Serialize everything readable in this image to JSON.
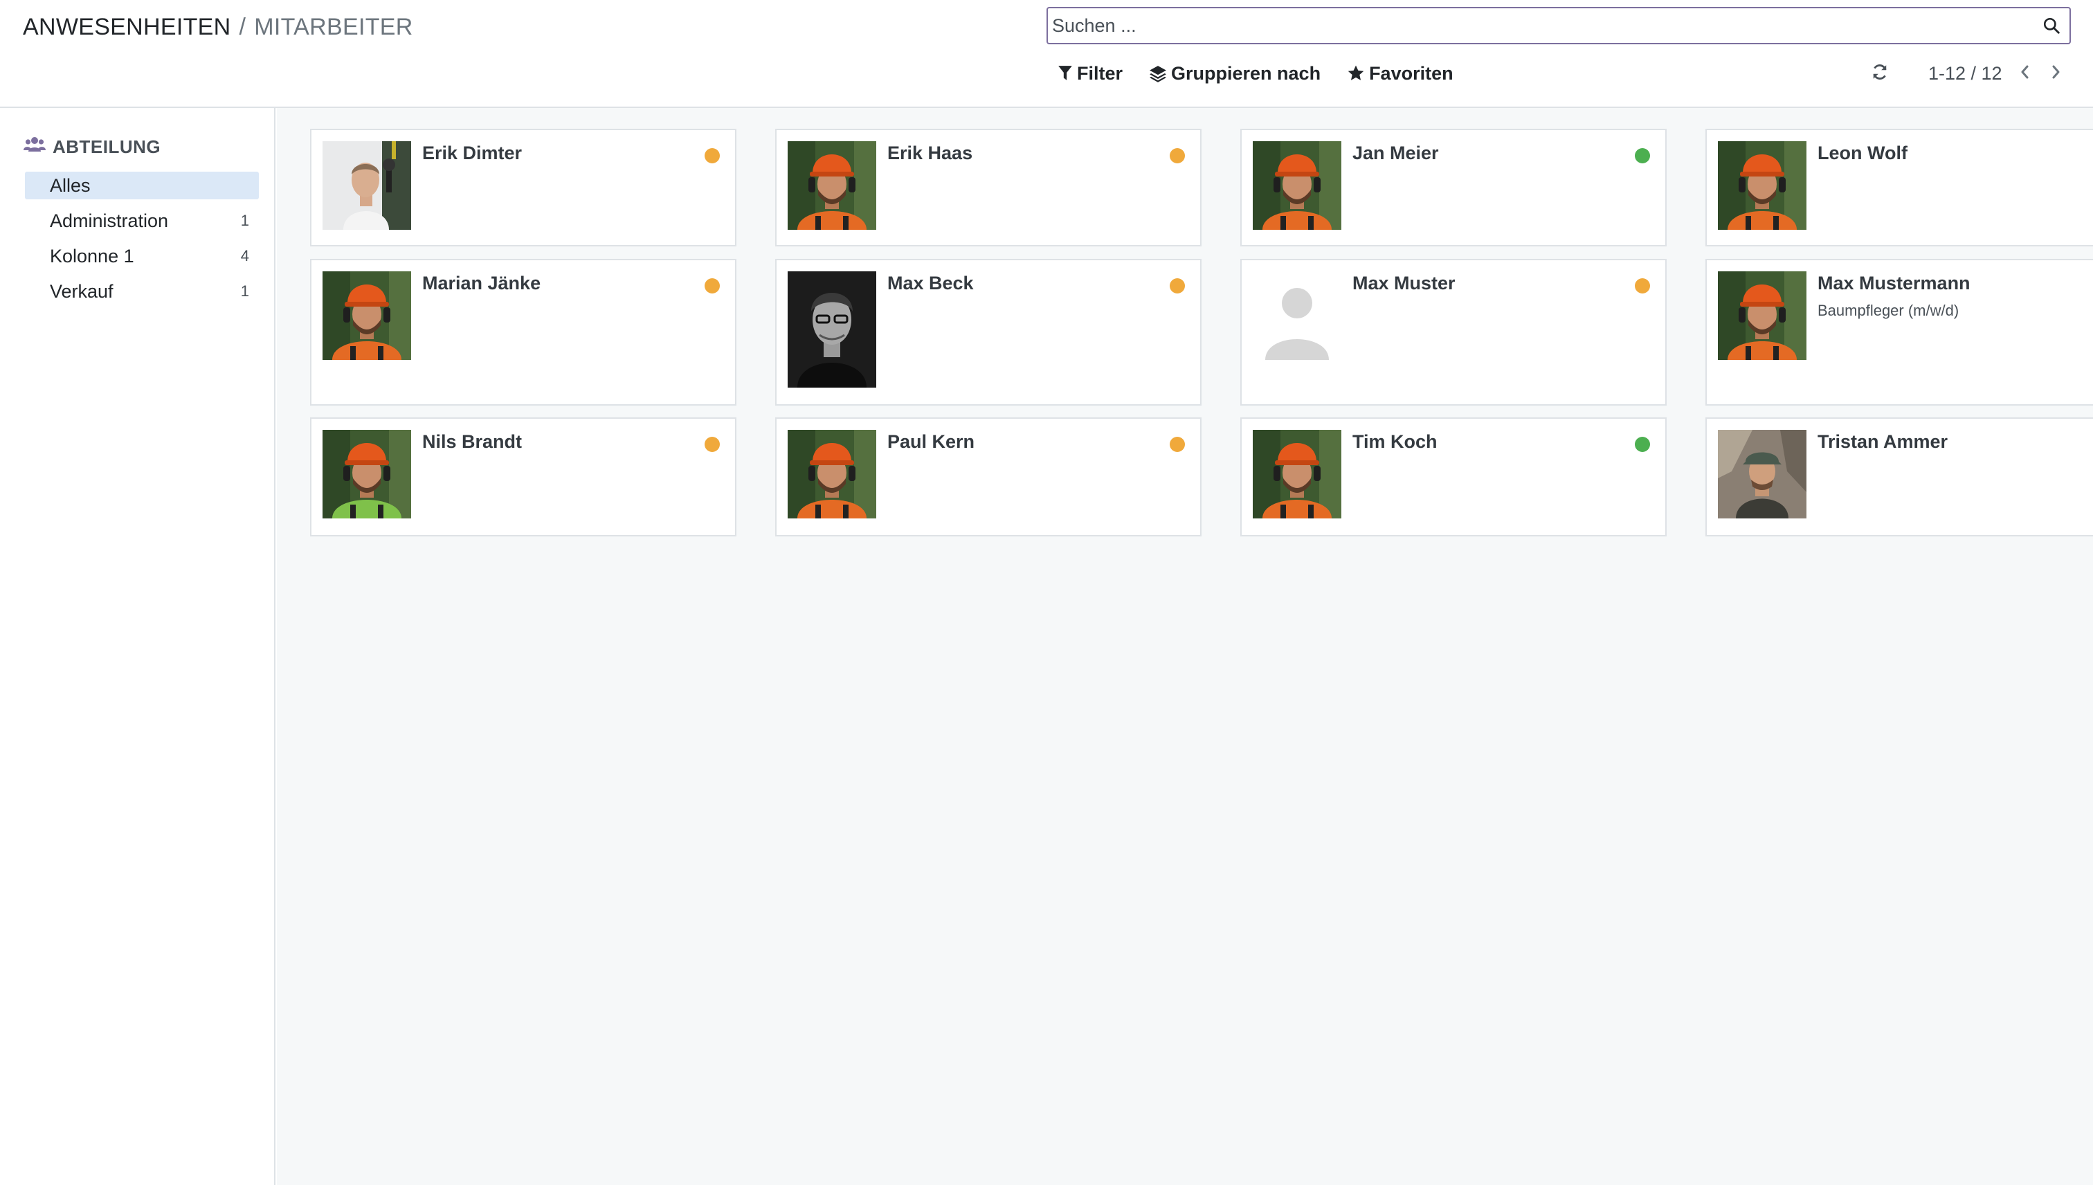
{
  "breadcrumb": {
    "parent": "ANWESENHEITEN",
    "separator": "/",
    "current": "MITARBEITER"
  },
  "search": {
    "placeholder": "Suchen ...",
    "value": ""
  },
  "toolbar": {
    "filter_label": "Filter",
    "group_by_label": "Gruppieren nach",
    "favorites_label": "Favoriten"
  },
  "pager": {
    "value": "1-12 / 12"
  },
  "sidebar": {
    "title": "ABTEILUNG",
    "items": [
      {
        "label": "Alles",
        "count": ""
      },
      {
        "label": "Administration",
        "count": "1"
      },
      {
        "label": "Kolonne 1",
        "count": "4"
      },
      {
        "label": "Verkauf",
        "count": "1"
      }
    ]
  },
  "colors": {
    "present": "#4caf50",
    "absent": "#f0a93b",
    "accent": "#7c6f9e",
    "active_filter": "#dbe8f7"
  },
  "employees": [
    {
      "name": "Erik Dimter",
      "job": "",
      "status": "absent",
      "avatar": "photo-office"
    },
    {
      "name": "Erik Haas",
      "job": "",
      "status": "absent",
      "avatar": "photo-arborist"
    },
    {
      "name": "Jan Meier",
      "job": "",
      "status": "present",
      "avatar": "photo-arborist"
    },
    {
      "name": "Leon Wolf",
      "job": "",
      "status": "present",
      "avatar": "photo-arborist"
    },
    {
      "name": "Marian Jänke",
      "job": "",
      "status": "absent",
      "avatar": "photo-arborist"
    },
    {
      "name": "Max Beck",
      "job": "",
      "status": "absent",
      "avatar": "photo-bw-portrait"
    },
    {
      "name": "Max Muster",
      "job": "",
      "status": "absent",
      "avatar": "placeholder-person"
    },
    {
      "name": "Max Mustermann",
      "job": "Baumpfleger (m/w/d)",
      "status": "absent",
      "avatar": "photo-arborist"
    },
    {
      "name": "Nils Brandt",
      "job": "",
      "status": "absent",
      "avatar": "photo-arborist-green"
    },
    {
      "name": "Paul Kern",
      "job": "",
      "status": "absent",
      "avatar": "photo-arborist"
    },
    {
      "name": "Tim Koch",
      "job": "",
      "status": "present",
      "avatar": "photo-arborist"
    },
    {
      "name": "Tristan Ammer",
      "job": "",
      "status": "absent",
      "avatar": "photo-outdoor"
    }
  ]
}
